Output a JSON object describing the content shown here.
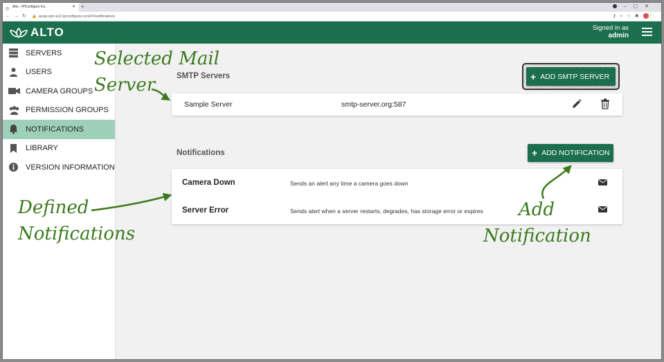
{
  "browser": {
    "tab_title": "Alto - IPConfigure Inc.",
    "url": "acap-vpn-ec2.ipconfigure.com/#!/notifications"
  },
  "header": {
    "logo_text": "ALTO",
    "signed_in_label": "Signed in as",
    "username": "admin",
    "brand_color": "#1b6e4e"
  },
  "sidebar": {
    "items": [
      {
        "label": "SERVERS",
        "icon": "server-icon"
      },
      {
        "label": "USERS",
        "icon": "user-icon"
      },
      {
        "label": "CAMERA GROUPS",
        "icon": "camera-icon"
      },
      {
        "label": "PERMISSION GROUPS",
        "icon": "group-icon"
      },
      {
        "label": "NOTIFICATIONS",
        "icon": "bell-icon",
        "active": true
      },
      {
        "label": "LIBRARY",
        "icon": "bookmark-icon"
      },
      {
        "label": "VERSION INFORMATION",
        "icon": "info-icon"
      }
    ],
    "active_color": "#9ecfb9"
  },
  "smtp": {
    "title": "SMTP Servers",
    "add_button": "ADD SMTP SERVER",
    "servers": [
      {
        "name": "Sample Server",
        "host": "smtp-server.org:587"
      }
    ]
  },
  "notifications": {
    "title": "Notifications",
    "add_button": "ADD NOTIFICATION",
    "items": [
      {
        "name": "Camera Down",
        "description": "Sends an alert any time a camera goes down"
      },
      {
        "name": "Server Error",
        "description": "Sends alert when a server restarts, degrades, has storage error or expires"
      }
    ]
  },
  "annotations": {
    "selected_mail_server_1": "Selected Mail",
    "selected_mail_server_2": "Server",
    "defined_notifications_1": "Defined",
    "defined_notifications_2": "Notifications",
    "add_notification_1": "Add",
    "add_notification_2": "Notification",
    "color": "#3d7a1f"
  }
}
